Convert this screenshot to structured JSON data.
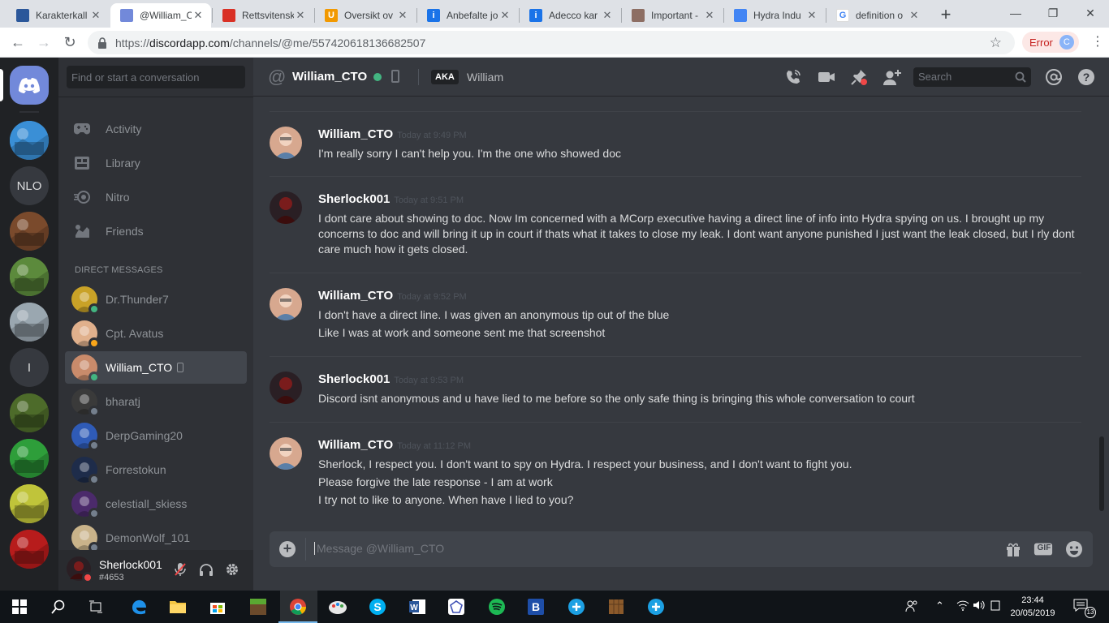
{
  "browser": {
    "tabs": [
      {
        "title": "Karakterkall",
        "favicon_color": "#2b579a",
        "favicon_glyph": "doc"
      },
      {
        "title": "@William_C",
        "favicon_color": "#7289da",
        "favicon_glyph": "discord"
      },
      {
        "title": "Rettsvitensk",
        "favicon_color": "#d93025",
        "favicon_glyph": "flag"
      },
      {
        "title": "Oversikt ov",
        "favicon_color": "#f29900",
        "favicon_glyph": "U"
      },
      {
        "title": "Anbefalte jo",
        "favicon_color": "#1a73e8",
        "favicon_glyph": "i"
      },
      {
        "title": "Adecco kar",
        "favicon_color": "#1a73e8",
        "favicon_glyph": "i"
      },
      {
        "title": "Important -",
        "favicon_color": "#8d6e63",
        "favicon_glyph": "img"
      },
      {
        "title": "Hydra Indu",
        "favicon_color": "#4285f4",
        "favicon_glyph": "doc"
      },
      {
        "title": "definition o",
        "favicon_color": "#ffffff",
        "favicon_glyph": "G"
      }
    ],
    "url": "https://discordapp.com/channels/@me/557420618136682507",
    "url_host": "discordapp.com",
    "error_label": "Error",
    "profile_initial": "C"
  },
  "guilds": [
    {
      "name": "home",
      "type": "home"
    },
    {
      "name": "guild-1",
      "type": "image",
      "color": "#3a8fd6"
    },
    {
      "name": "NLO",
      "type": "text",
      "label": "NLO"
    },
    {
      "name": "guild-3",
      "type": "image",
      "color": "#7a4a2c"
    },
    {
      "name": "guild-4",
      "type": "image",
      "color": "#5c8a3c"
    },
    {
      "name": "guild-5",
      "type": "image",
      "color": "#9aa7b0"
    },
    {
      "name": "I",
      "type": "text",
      "label": "I"
    },
    {
      "name": "guild-7",
      "type": "image",
      "color": "#4d6b2a"
    },
    {
      "name": "guild-8",
      "type": "image",
      "color": "#2e9e3a"
    },
    {
      "name": "guild-9",
      "type": "image",
      "color": "#c0c43a"
    },
    {
      "name": "guild-10",
      "type": "image",
      "color": "#b71c1c"
    }
  ],
  "sidebar": {
    "search_placeholder": "Find or start a conversation",
    "nav": [
      {
        "label": "Activity",
        "icon": "gamepad-icon"
      },
      {
        "label": "Library",
        "icon": "library-icon"
      },
      {
        "label": "Nitro",
        "icon": "nitro-icon"
      },
      {
        "label": "Friends",
        "icon": "friends-icon"
      }
    ],
    "dm_header": "DIRECT MESSAGES",
    "dms": [
      {
        "name": "Dr.Thunder7",
        "status": "online",
        "color": "#c9a227"
      },
      {
        "name": "Cpt. Avatus",
        "status": "idle",
        "color": "#e0b08c"
      },
      {
        "name": "William_CTO",
        "status": "online",
        "color": "#c98b6b",
        "selected": true,
        "mobile": true
      },
      {
        "name": "bharatj",
        "status": "offline",
        "color": "#3a3a3a"
      },
      {
        "name": "DerpGaming20",
        "status": "offline",
        "color": "#2f5bb7"
      },
      {
        "name": "Forrestokun",
        "status": "offline",
        "color": "#1e2c4a"
      },
      {
        "name": "celestiall_skiess",
        "status": "offline",
        "color": "#4b2a6b"
      },
      {
        "name": "DemonWolf_101",
        "status": "offline",
        "color": "#c9b38a"
      }
    ],
    "user": {
      "name": "Sherlock001",
      "tag": "#4653",
      "status": "dnd"
    }
  },
  "chat": {
    "header": {
      "name": "William_CTO",
      "aka": "AKA",
      "nickname": "William",
      "search_placeholder": "Search"
    },
    "messages": [
      {
        "author": "William_CTO",
        "time": "Today at 9:49 PM",
        "lines": [
          "I'm really sorry I can't help you. I'm the one who showed doc"
        ]
      },
      {
        "author": "Sherlock001",
        "time": "Today at 9:51 PM",
        "lines": [
          "I dont care about showing to doc. Now Im concerned with a MCorp executive having a direct line of info into Hydra spying on us. I brought up my",
          "concerns to doc and will bring it up in court if thats what it takes to close my leak. I dont want anyone punished I just want the leak closed, but I rly dont",
          "care much how it gets closed."
        ]
      },
      {
        "author": "William_CTO",
        "time": "Today at 9:52 PM",
        "lines": [
          "I don't have a direct line. I was given an anonymous tip out of the blue",
          "Like I was at work and someone sent me that screenshot"
        ]
      },
      {
        "author": "Sherlock001",
        "time": "Today at 9:53 PM",
        "lines": [
          "Discord isnt anonymous and u have lied to me before so the only safe thing is bringing this whole conversation to court"
        ]
      },
      {
        "author": "William_CTO",
        "time": "Today at 11:12 PM",
        "lines": [
          "Sherlock, I respect you. I don't want to spy on Hydra. I respect your business, and I don't want to fight you.",
          "Please forgive the late response - I am at work",
          "I try not to like to anyone. When have I lied to you?"
        ]
      }
    ],
    "composer_placeholder": "Message @William_CTO",
    "gif_label": "GIF"
  },
  "taskbar": {
    "apps": [
      "start-icon",
      "search-icon",
      "task-view-icon",
      "edge-icon",
      "file-explorer-icon",
      "store-icon",
      "minecraft-icon",
      "chrome-icon",
      "paint-icon",
      "skype-icon",
      "word-icon",
      "app-icon",
      "spotify-icon",
      "b-app-icon",
      "plus-app-icon",
      "minecraft-launcher-icon",
      "plus-app-icon-2"
    ],
    "time": "23:44",
    "date": "20/05/2019",
    "notifications": "13"
  },
  "colors": {
    "blurple": "#7289da",
    "online": "#43b581",
    "idle": "#faa61a",
    "dnd": "#f04747",
    "offline": "#747f8d"
  }
}
